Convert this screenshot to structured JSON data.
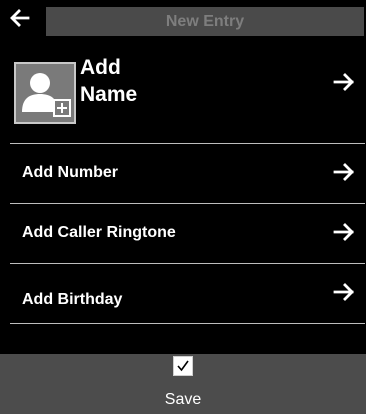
{
  "header": {
    "title": "New Entry",
    "back_icon": "back-arrow-icon"
  },
  "contact": {
    "name_label_line1": "Add",
    "name_label_line2": "Name",
    "avatar_icon": "add-photo-person-icon"
  },
  "rows": [
    {
      "label": "Add Number",
      "icon": "arrow-right-icon"
    },
    {
      "label": "Add Caller Ringtone",
      "icon": "arrow-right-icon"
    },
    {
      "label": "Add Birthday",
      "icon": "arrow-right-icon"
    }
  ],
  "footer": {
    "save_label": "Save",
    "checkbox_icon": "checkmark-icon"
  },
  "colors": {
    "background": "#000000",
    "title_field": "#4a4a4a",
    "title_text": "#7e7e7e",
    "footer": "#4c4c4c",
    "separator": "#bdbdbd"
  }
}
